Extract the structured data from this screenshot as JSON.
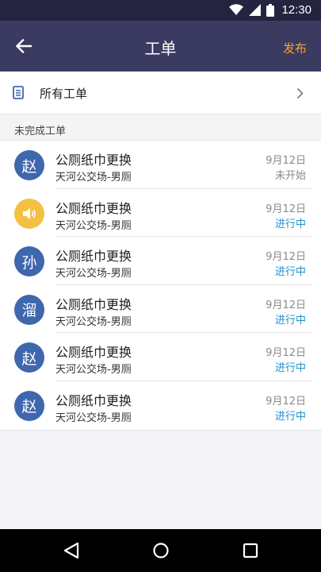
{
  "status_bar": {
    "time": "12:30",
    "icons": [
      "wifi-icon",
      "signal-icon",
      "battery-icon"
    ]
  },
  "app_bar": {
    "title": "工单",
    "publish_label": "发布",
    "back_icon": "arrow-left-icon"
  },
  "all_orders": {
    "label": "所有工单",
    "icon": "document-icon",
    "chevron": "chevron-right-icon"
  },
  "section": {
    "title": "未完成工单"
  },
  "colors": {
    "app_bar": "#3b3a61",
    "status_bar": "#25243f",
    "accent_orange": "#f0a52a",
    "status_blue": "#1f8fd0",
    "status_gray": "#8a8a8a",
    "avatar_blue": "#3f67ad",
    "avatar_yellow": "#f4c043"
  },
  "orders": [
    {
      "avatar_text": "赵",
      "avatar_color": "#3f67ad",
      "title": "公厕纸巾更换",
      "location": "天河公交场-男厕",
      "date": "9月12日",
      "status": "未开始",
      "status_color": "#8a8a8a"
    },
    {
      "avatar_text": "",
      "avatar_icon": "speaker-icon",
      "avatar_color": "#f4c043",
      "title": "公厕纸巾更换",
      "location": "天河公交场-男厕",
      "date": "9月12日",
      "status": "进行中",
      "status_color": "#1f8fd0"
    },
    {
      "avatar_text": "孙",
      "avatar_color": "#3f67ad",
      "title": "公厕纸巾更换",
      "location": "天河公交场-男厕",
      "date": "9月12日",
      "status": "进行中",
      "status_color": "#1f8fd0"
    },
    {
      "avatar_text": "溜",
      "avatar_color": "#3f67ad",
      "title": "公厕纸巾更换",
      "location": "天河公交场-男厕",
      "date": "9月12日",
      "status": "进行中",
      "status_color": "#1f8fd0"
    },
    {
      "avatar_text": "赵",
      "avatar_color": "#3f67ad",
      "title": "公厕纸巾更换",
      "location": "天河公交场-男厕",
      "date": "9月12日",
      "status": "进行中",
      "status_color": "#1f8fd0"
    },
    {
      "avatar_text": "赵",
      "avatar_color": "#3f67ad",
      "title": "公厕纸巾更换",
      "location": "天河公交场-男厕",
      "date": "9月12日",
      "status": "进行中",
      "status_color": "#1f8fd0"
    }
  ],
  "nav_bar": {
    "buttons": [
      "back-triangle-icon",
      "home-circle-icon",
      "recents-square-icon"
    ]
  }
}
